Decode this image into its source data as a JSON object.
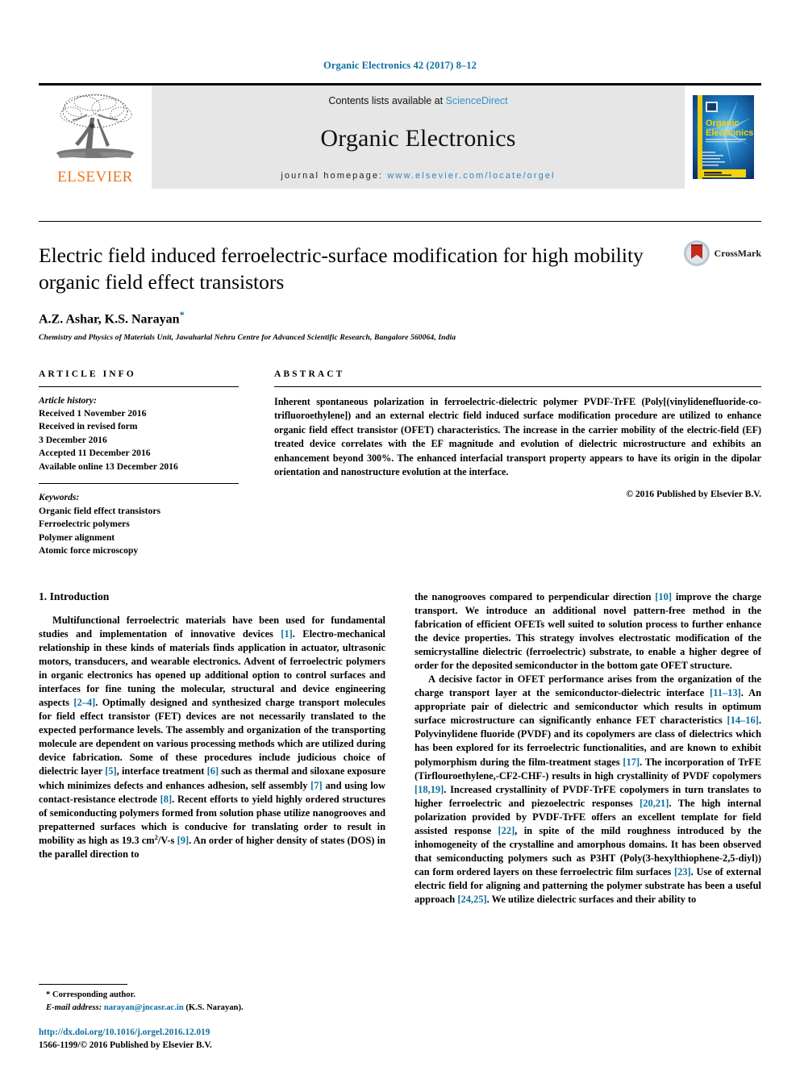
{
  "running_head": "Organic Electronics 42 (2017) 8–12",
  "masthead": {
    "publisher_name": "ELSEVIER",
    "contents_prefix": "Contents lists available at ",
    "contents_link": "ScienceDirect",
    "journal_title": "Organic Electronics",
    "homepage_prefix": "journal homepage: ",
    "homepage_url": "www.elsevier.com/locate/orgel",
    "cover_title_line1": "Organic",
    "cover_title_line2": "Electronics",
    "cover_subtitle": "materials • physics • chemistry • applications"
  },
  "article": {
    "title": "Electric field induced ferroelectric-surface modification for high mobility organic field effect transistors",
    "authors": "A.Z. Ashar, K.S. Narayan",
    "corresponding_marker": "*",
    "affiliation": "Chemistry and Physics of Materials Unit, Jawaharlal Nehru Centre for Advanced Scientific Research, Bangalore 560064, India",
    "crossmark_label": "CrossMark"
  },
  "article_info": {
    "heading": "ARTICLE INFO",
    "history_label": "Article history:",
    "history": [
      "Received 1 November 2016",
      "Received in revised form",
      "3 December 2016",
      "Accepted 11 December 2016",
      "Available online 13 December 2016"
    ],
    "keywords_label": "Keywords:",
    "keywords": [
      "Organic field effect transistors",
      "Ferroelectric polymers",
      "Polymer alignment",
      "Atomic force microscopy"
    ]
  },
  "abstract": {
    "heading": "ABSTRACT",
    "text": "Inherent spontaneous polarization in ferroelectric-dielectric polymer PVDF-TrFE (Poly[(vinylidenefluoride-co-trifluoroethylene]) and an external electric field induced surface modification procedure are utilized to enhance organic field effect transistor (OFET) characteristics. The increase in the carrier mobility of the electric-field (EF) treated device correlates with the EF magnitude and evolution of dielectric microstructure and exhibits an enhancement beyond 300%. The enhanced interfacial transport property appears to have its origin in the dipolar orientation and nanostructure evolution at the interface.",
    "copyright": "© 2016 Published by Elsevier B.V."
  },
  "body": {
    "section_heading": "1. Introduction",
    "left_paragraphs": [
      {
        "segments": [
          {
            "t": "Multifunctional ferroelectric materials have been used for fundamental studies and implementation of innovative devices "
          },
          {
            "t": "[1]",
            "ref": true
          },
          {
            "t": ". Electro-mechanical relationship in these kinds of materials finds application in actuator, ultrasonic motors, transducers, and wearable electronics. Advent of ferroelectric polymers in organic electronics has opened up additional option to control surfaces and interfaces for fine tuning the molecular, structural and device engineering aspects "
          },
          {
            "t": "[2–4]",
            "ref": true
          },
          {
            "t": ". Optimally designed and synthesized charge transport molecules for field effect transistor (FET) devices are not necessarily translated to the expected performance levels. The assembly and organization of the transporting molecule are dependent on various processing methods which are utilized during device fabrication. Some of these procedures include judicious choice of dielectric layer "
          },
          {
            "t": "[5]",
            "ref": true
          },
          {
            "t": ", interface treatment "
          },
          {
            "t": "[6]",
            "ref": true
          },
          {
            "t": " such as thermal and siloxane exposure which minimizes defects and enhances adhesion, self assembly "
          },
          {
            "t": "[7]",
            "ref": true
          },
          {
            "t": " and using low contact-resistance electrode "
          },
          {
            "t": "[8]",
            "ref": true
          },
          {
            "t": ". Recent efforts to yield highly ordered structures of semiconducting polymers formed from solution phase utilize nanogrooves and prepatterned surfaces which is conducive for translating order to result in mobility as high as 19.3 cm"
          },
          {
            "t": "2",
            "sup": true
          },
          {
            "t": "/V-s "
          },
          {
            "t": "[9]",
            "ref": true
          },
          {
            "t": ". An order of higher density of states (DOS) in the parallel direction to"
          }
        ]
      }
    ],
    "right_paragraphs": [
      {
        "no_indent": true,
        "segments": [
          {
            "t": "the nanogrooves compared to perpendicular direction "
          },
          {
            "t": "[10]",
            "ref": true
          },
          {
            "t": " improve the charge transport. We introduce an additional novel pattern-free method in the fabrication of efficient OFETs well suited to solution process to further enhance the device properties. This strategy involves electrostatic modification of the semicrystalline dielectric (ferroelectric) substrate, to enable a higher degree of order for the deposited semiconductor in the bottom gate OFET structure."
          }
        ]
      },
      {
        "segments": [
          {
            "t": "A decisive factor in OFET performance arises from the organization of the charge transport layer at the semiconductor-dielectric interface "
          },
          {
            "t": "[11–13]",
            "ref": true
          },
          {
            "t": ". An appropriate pair of dielectric and semiconductor which results in optimum surface microstructure can significantly enhance FET characteristics "
          },
          {
            "t": "[14–16]",
            "ref": true
          },
          {
            "t": ". Polyvinylidene fluoride (PVDF) and its copolymers are class of dielectrics which has been explored for its ferroelectric functionalities, and are known to exhibit polymorphism during the film-treatment stages "
          },
          {
            "t": "[17]",
            "ref": true
          },
          {
            "t": ". The incorporation of TrFE (Tirflouroethylene,-CF2-CHF-) results in high crystallinity of PVDF copolymers "
          },
          {
            "t": "[18,19]",
            "ref": true
          },
          {
            "t": ". Increased crystallinity of PVDF-TrFE copolymers in turn translates to higher ferroelectric and piezoelectric responses "
          },
          {
            "t": "[20,21]",
            "ref": true
          },
          {
            "t": ". The high internal polarization provided by PVDF-TrFE offers an excellent template for field assisted response "
          },
          {
            "t": "[22]",
            "ref": true
          },
          {
            "t": ", in spite of the mild roughness introduced by the inhomogeneity of the crystalline and amorphous domains. It has been observed that semiconducting polymers such as P3HT (Poly(3-hexylthiophene-2,5-diyl)) can form ordered layers on these ferroelectric film surfaces "
          },
          {
            "t": "[23]",
            "ref": true
          },
          {
            "t": ". Use of external electric field for aligning and patterning the polymer substrate has been a useful approach "
          },
          {
            "t": "[24,25]",
            "ref": true
          },
          {
            "t": ". We utilize dielectric surfaces and their ability to"
          }
        ]
      }
    ]
  },
  "footnote": {
    "corresponding_marker": "*",
    "corresponding_text": "Corresponding author.",
    "email_label": "E-mail address:",
    "email": "narayan@jncasr.ac.in",
    "email_owner": "(K.S. Narayan)."
  },
  "publication": {
    "doi": "http://dx.doi.org/10.1016/j.orgel.2016.12.019",
    "issn_line": "1566-1199/© 2016 Published by Elsevier B.V."
  },
  "colors": {
    "link_blue": "#0d6ea0",
    "elsevier_orange": "#E87722",
    "masthead_gray": "#e6e6e6"
  }
}
